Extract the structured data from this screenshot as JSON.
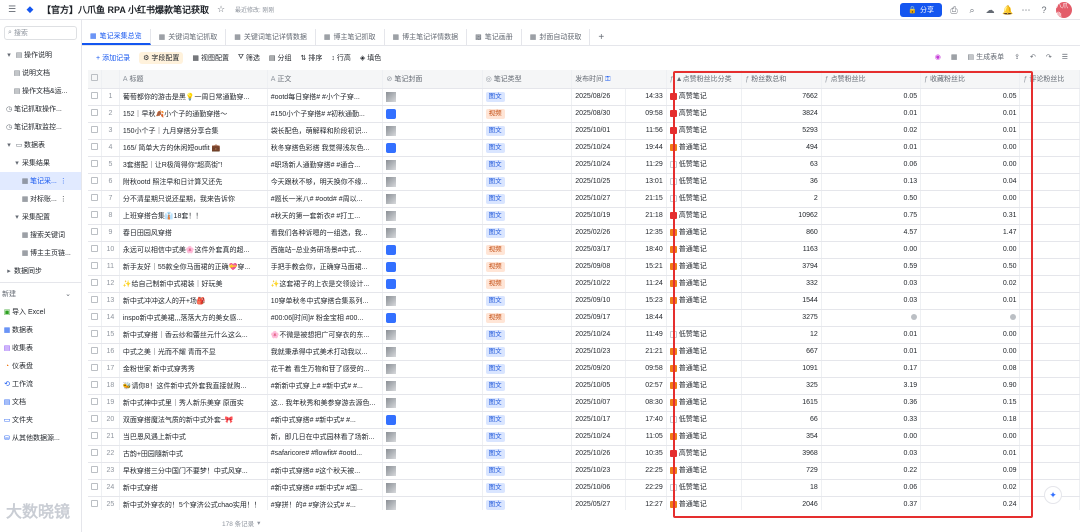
{
  "header": {
    "title": "【官方】八爪鱼 RPA 小红书爆款笔记获取",
    "subtitle": "最近修改: 刚刚",
    "share_label": "分享",
    "avatar_text": "八爪鱼"
  },
  "sidebar": {
    "search_placeholder": "搜索",
    "items": [
      {
        "label": "操作说明",
        "icon": "doc-icon"
      },
      {
        "label": "说明文档",
        "icon": "doc-icon"
      },
      {
        "label": "操作文档&运...",
        "icon": "doc-icon"
      },
      {
        "label": "笔记抓取操作...",
        "icon": "clock-icon"
      },
      {
        "label": "笔记抓取监控...",
        "icon": "clock-icon"
      },
      {
        "label": "数据表",
        "icon": "folder-icon"
      },
      {
        "label": "采集结果",
        "icon": "folder-icon"
      },
      {
        "label": "笔记采...",
        "icon": "table-icon"
      },
      {
        "label": "对标账...",
        "icon": "table-icon"
      },
      {
        "label": "采集配置",
        "icon": "folder-icon"
      },
      {
        "label": "搜索关键词",
        "icon": "table-icon"
      },
      {
        "label": "博主主页链...",
        "icon": "table-icon"
      },
      {
        "label": "数据同步",
        "icon": "folder-icon"
      }
    ],
    "new_label": "新建",
    "bottom_items": [
      "导入 Excel",
      "数据表",
      "收集表",
      "仪表盘",
      "工作流",
      "文档",
      "文件夹",
      "从其他数据源..."
    ]
  },
  "tabs": [
    "笔记采集总览",
    "关键词笔记抓取",
    "关键词笔记详情数据",
    "博主笔记抓取",
    "博主笔记详情数据",
    "笔记画册",
    "封面自动获取"
  ],
  "toolbar": {
    "add_label": "添加记录",
    "field_label": "字段配置",
    "view_label": "视图配置",
    "filter_label": "筛选",
    "group_label": "分组",
    "sort_label": "排序",
    "row_label": "行高",
    "fill_label": "填色",
    "form_label": "生成表单"
  },
  "columns": [
    "标题",
    "正文",
    "笔记封面",
    "笔记类型",
    "发布时间",
    "点赞粉丝比分类",
    "粉丝数总和",
    "点赞粉丝比",
    "收藏粉丝比",
    "评论粉丝比"
  ],
  "rows": [
    {
      "title": "葡萄都你的游击是黑💡一周日常通勤穿...",
      "body": "#ootd每日穿搭# #小个子穿...",
      "cover": "img",
      "type": "图文",
      "date": "2025/08/26",
      "time": "14:33",
      "level": "高赞笔记",
      "fans": "7662",
      "like": "0.05",
      "fav": "0.05"
    },
    {
      "title": "152｜早秋🍂小个子的通勤穿搭～",
      "body": "#150小个子穿搭# #初秋通勤...",
      "cover": "video",
      "type": "视频",
      "date": "2025/08/30",
      "time": "09:58",
      "level": "高赞笔记",
      "fans": "3824",
      "like": "0.01",
      "fav": "0.01"
    },
    {
      "title": "150小个子｜九月穿搭分享合集",
      "body": "袋长配色，萌解释和阶段初识...",
      "cover": "img",
      "type": "图文",
      "date": "2025/10/01",
      "time": "11:56",
      "level": "高赞笔记",
      "fans": "5293",
      "like": "0.02",
      "fav": "0.01"
    },
    {
      "title": "165/ 简单大方的休闲短outfit 💼",
      "body": "秋冬穿搭色彩搭 我觉得浅灰色...",
      "cover": "video",
      "type": "图文",
      "date": "2025/10/24",
      "time": "19:44",
      "level": "普通笔记",
      "fans": "494",
      "like": "0.01",
      "fav": "0.00"
    },
    {
      "title": "3套搭配｜让R极简得你“超高街”!",
      "body": "#职场新人通勤穿搭# #通合...",
      "cover": "img",
      "type": "图文",
      "date": "2025/10/24",
      "time": "11:29",
      "level": "低赞笔记",
      "fans": "63",
      "like": "0.06",
      "fav": "0.00"
    },
    {
      "title": "附秋ootd 照注早和日计算又还先",
      "body": "今天跟秋不够，明天换你不缘...",
      "cover": "img",
      "type": "图文",
      "date": "2025/10/25",
      "time": "13:01",
      "level": "低赞笔记",
      "fans": "36",
      "like": "0.13",
      "fav": "0.04"
    },
    {
      "title": "分不清星期只说还星期，我来告诉你",
      "body": "#题长一米八# #ootd# #周以...",
      "cover": "img",
      "type": "图文",
      "date": "2025/10/27",
      "time": "21:15",
      "level": "低赞笔记",
      "fans": "2",
      "like": "0.50",
      "fav": "0.00"
    },
    {
      "title": "上班穿搭合集👔18套！！",
      "body": "#秋天的第一套新衣# #打工...",
      "cover": "img",
      "type": "图文",
      "date": "2025/10/19",
      "time": "21:18",
      "level": "高赞笔记",
      "fans": "10962",
      "like": "0.75",
      "fav": "0.31"
    },
    {
      "title": "春日田园风穿搭",
      "body": "看我们各种诉嗯的一组选，我...",
      "cover": "img",
      "type": "图文",
      "date": "2025/02/26",
      "time": "12:35",
      "level": "普通笔记",
      "fans": "860",
      "like": "4.57",
      "fav": "1.47"
    },
    {
      "title": "永远可以相信中式美🌸这件外套真的超...",
      "body": "西施站~总业务研场景#中式...",
      "cover": "video",
      "type": "视频",
      "date": "2025/03/17",
      "time": "18:40",
      "level": "普通笔记",
      "fans": "1163",
      "like": "0.00",
      "fav": "0.00"
    },
    {
      "title": "新手友好｜55款全你马面裙的正确💝穿...",
      "body": "手把手教会你，正确穿马面裙...",
      "cover": "video",
      "type": "视频",
      "date": "2025/09/08",
      "time": "15:21",
      "level": "普通笔记",
      "fans": "3794",
      "like": "0.59",
      "fav": "0.50"
    },
    {
      "title": "✨给自己制新中式裙装｜好玩美",
      "body": "✨这套裙子的上衣是交领设计...",
      "cover": "video",
      "type": "视频",
      "date": "2025/10/22",
      "time": "11:24",
      "level": "普通笔记",
      "fans": "332",
      "like": "0.03",
      "fav": "0.02"
    },
    {
      "title": "新中式冲冲这人的开+场🎒",
      "body": "10穿单秋冬中式穿搭合集系列...",
      "cover": "img",
      "type": "图文",
      "date": "2025/09/10",
      "time": "15:23",
      "level": "普通笔记",
      "fans": "1544",
      "like": "0.03",
      "fav": "0.01"
    },
    {
      "title": "inspo新中式美裙,,,落落大方的美女感...",
      "body": "#00:06[时间]# 粉金宝相 #00...",
      "cover": "video",
      "type": "视频",
      "date": "2025/09/17",
      "time": "18:44",
      "level": "",
      "fans": "3275",
      "like": "",
      "fav": ""
    },
    {
      "title": "新中式穿搭｜香云纱和蕾丝元什么这么...",
      "body": "🌸不微是被想把广可穿衣的东...",
      "cover": "img",
      "type": "图文",
      "date": "2025/10/24",
      "time": "11:49",
      "level": "低赞笔记",
      "fans": "12",
      "like": "0.01",
      "fav": "0.00"
    },
    {
      "title": "中式之美｜光而不耀 青而不显",
      "body": "我就秉承得中式美术打动我以...",
      "cover": "img",
      "type": "图文",
      "date": "2025/10/23",
      "time": "21:21",
      "level": "普通笔记",
      "fans": "667",
      "like": "0.01",
      "fav": "0.00"
    },
    {
      "title": "金粉世家 新中式穿秀秀",
      "body": "花干着 看生万物和苷了感受的...",
      "cover": "img",
      "type": "图文",
      "date": "2025/09/20",
      "time": "09:58",
      "level": "普通笔记",
      "fans": "1091",
      "like": "0.17",
      "fav": "0.08"
    },
    {
      "title": "🐝请你8！这件新中式外套我直接就购...",
      "body": "#新新中式穿上# #新中式# #...",
      "cover": "img",
      "type": "图文",
      "date": "2025/10/05",
      "time": "02:57",
      "level": "普通笔记",
      "fans": "325",
      "like": "3.19",
      "fav": "0.90"
    },
    {
      "title": "新中式神中式里｜秀人新乐美穿 原面实",
      "body": "这... 我年秋秀和美参穿游去源色...",
      "cover": "img",
      "type": "图文",
      "date": "2025/10/07",
      "time": "08:30",
      "level": "普通笔记",
      "fans": "1615",
      "like": "0.36",
      "fav": "0.15"
    },
    {
      "title": "双面穿搭魔法气质的新中式外套~🎀",
      "body": "#新中式穿搭# #新中式# #...",
      "cover": "video",
      "type": "图文",
      "date": "2025/10/17",
      "time": "17:40",
      "level": "低赞笔记",
      "fans": "66",
      "like": "0.33",
      "fav": "0.18"
    },
    {
      "title": "当巴恩风遇上新中式",
      "body": "新，即几日在中式园林看了场新...",
      "cover": "img",
      "type": "图文",
      "date": "2025/10/24",
      "time": "11:05",
      "level": "普通笔记",
      "fans": "354",
      "like": "0.00",
      "fav": "0.00"
    },
    {
      "title": "古韵+田园隨新中式",
      "body": "#safaricore# #flowfit# #ootd...",
      "cover": "img",
      "type": "图文",
      "date": "2025/10/26",
      "time": "10:35",
      "level": "高赞笔记",
      "fans": "3968",
      "like": "0.03",
      "fav": "0.01"
    },
    {
      "title": "早秋穿搭三分中国门不要梦！中式风穿...",
      "body": "#新中式穿搭# #这个秋天被...",
      "cover": "img",
      "type": "图文",
      "date": "2025/10/23",
      "time": "22:25",
      "level": "普通笔记",
      "fans": "729",
      "like": "0.22",
      "fav": "0.09"
    },
    {
      "title": "新中式穿搭",
      "body": "#新中式穿搭# #新中式# #国...",
      "cover": "img",
      "type": "图文",
      "date": "2025/10/06",
      "time": "22:29",
      "level": "低赞笔记",
      "fans": "18",
      "like": "0.06",
      "fav": "0.02"
    },
    {
      "title": "新中式外穿衣的！5个穿济公式chao实用！！",
      "body": "#穿拼！的# #穿济公式# #...",
      "cover": "img",
      "type": "图文",
      "date": "2025/05/27",
      "time": "12:27",
      "level": "普通笔记",
      "fans": "2046",
      "like": "0.37",
      "fav": "0.24"
    }
  ],
  "colors": {
    "high": "#e52e2e",
    "normal": "#f07c17",
    "low": "#c9cdd4",
    "accent": "#1456f0"
  },
  "footer": {
    "record_count": "178 条记录"
  },
  "watermark": "大数晓镜"
}
